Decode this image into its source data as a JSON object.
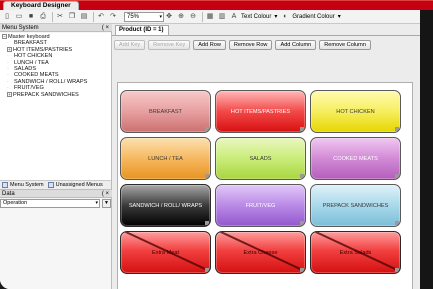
{
  "app": {
    "title": "Keyboard Designer"
  },
  "toolbar": {
    "zoom": "75%",
    "text_colour_label": "Text Colour",
    "gradient_colour_label": "Gradient Colour"
  },
  "left_panel": {
    "menu_system_title": "Menu System",
    "pin": "( ×",
    "tree": [
      {
        "label": "Master keyboard",
        "toggle": "−",
        "indent": 0
      },
      {
        "label": "BREAKFAST",
        "toggle": "",
        "indent": 1
      },
      {
        "label": "HOT ITEMS/PASTRIES",
        "toggle": "+",
        "indent": 1
      },
      {
        "label": "HOT CHICKEN",
        "toggle": "",
        "indent": 1
      },
      {
        "label": "LUNCH / TEA",
        "toggle": "",
        "indent": 1
      },
      {
        "label": "SALADS",
        "toggle": "",
        "indent": 1
      },
      {
        "label": "COOKED MEATS",
        "toggle": "",
        "indent": 1
      },
      {
        "label": "SANDWICH / ROLL/ WRAPS",
        "toggle": "",
        "indent": 1
      },
      {
        "label": "FRUIT/VEG",
        "toggle": "",
        "indent": 1
      },
      {
        "label": "PREPACK SANDWICHES",
        "toggle": "+",
        "indent": 1
      }
    ],
    "tabs": [
      "Menu System",
      "Unassigned Menus"
    ],
    "data_title": "Data",
    "data_value": "Operation"
  },
  "main": {
    "tab_label": "Product (ID = 1)",
    "buttons": [
      "Add Key",
      "Remove Key",
      "Add Row",
      "Remove Row",
      "Add Column",
      "Remove Column"
    ],
    "keys": [
      {
        "label": "BREAKFAST",
        "style": "k-breakfast",
        "crossed": false
      },
      {
        "label": "HOT ITEMS/PASTRIES",
        "style": "k-hot",
        "crossed": false
      },
      {
        "label": "HOT CHICKEN",
        "style": "k-chicken",
        "crossed": false
      },
      {
        "label": "LUNCH / TEA",
        "style": "k-lunch",
        "crossed": false
      },
      {
        "label": "SALADS",
        "style": "k-salads",
        "crossed": false
      },
      {
        "label": "COOKED MEATS",
        "style": "k-meats",
        "crossed": false
      },
      {
        "label": "SANDWICH / ROLL/ WRAPS",
        "style": "k-sandwich",
        "crossed": false
      },
      {
        "label": "FRUIT/VEG",
        "style": "k-fruit",
        "crossed": false
      },
      {
        "label": "PREPACK SANDWICHES",
        "style": "k-prepack",
        "crossed": false
      },
      {
        "label": "Extra Meat",
        "style": "k-extra",
        "crossed": true
      },
      {
        "label": "Extra Cheese",
        "style": "k-extra",
        "crossed": true
      },
      {
        "label": "Extra Salads",
        "style": "k-extra",
        "crossed": true
      }
    ]
  },
  "colors": {
    "accent": "#c40012"
  }
}
